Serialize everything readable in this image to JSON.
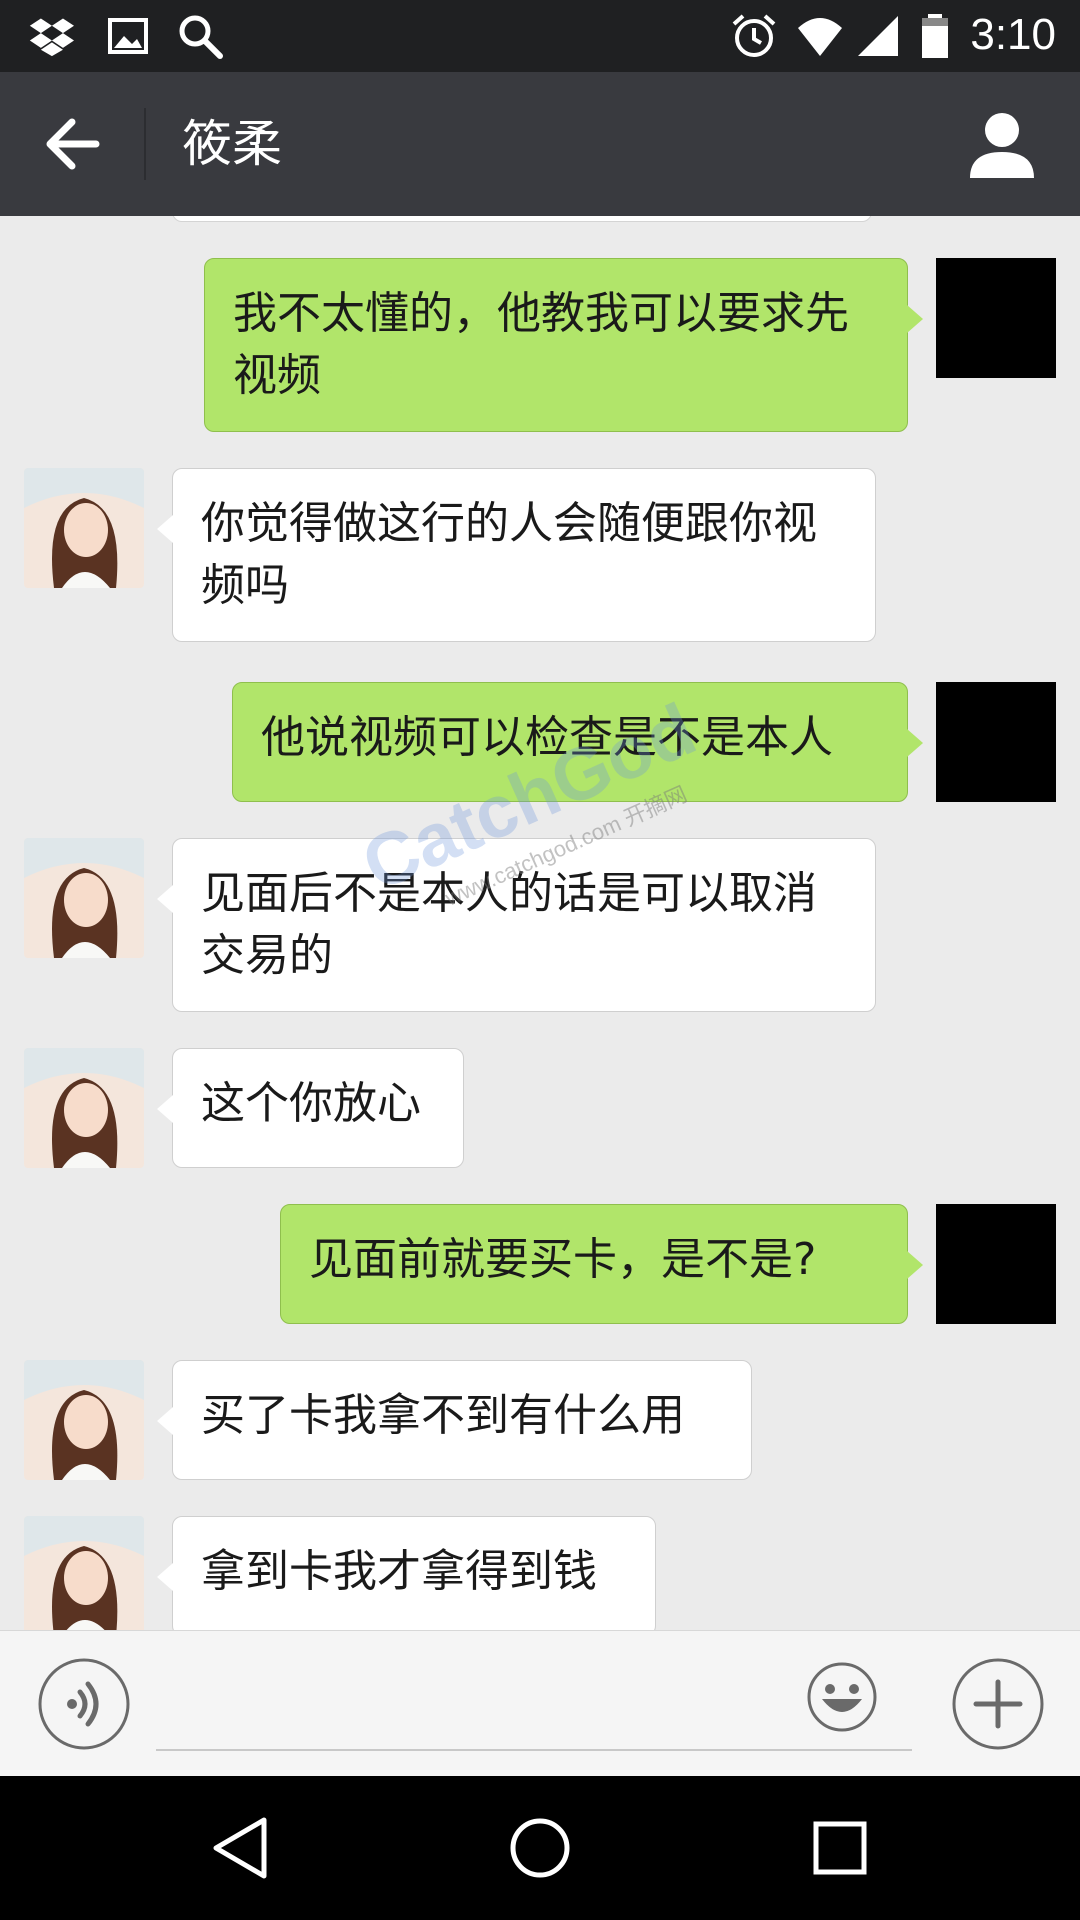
{
  "status_bar": {
    "time": "3:10",
    "left_icons": [
      "dropbox-icon",
      "image-icon",
      "search-icon"
    ],
    "right_icons": [
      "alarm-icon",
      "wifi-icon",
      "signal-icon",
      "battery-icon"
    ]
  },
  "header": {
    "title": "筱柔"
  },
  "messages": [
    {
      "side": "sent",
      "text": "我不太懂的，他教我可以要求先视频"
    },
    {
      "side": "received",
      "text": "你觉得做这行的人会随便跟你视频吗"
    },
    {
      "side": "sent",
      "text": "他说视频可以检查是不是本人"
    },
    {
      "side": "received",
      "text": "见面后不是本人的话是可以取消交易的"
    },
    {
      "side": "received",
      "text": "这个你放心"
    },
    {
      "side": "sent",
      "text": "见面前就要买卡，是不是?"
    },
    {
      "side": "received",
      "text": "买了卡我拿不到有什么用"
    },
    {
      "side": "received",
      "text": "拿到卡我才拿得到钱"
    }
  ],
  "watermark": {
    "main": "CatchGod",
    "sub": "www.catchgod.com 开摘网"
  },
  "input_bar": {
    "placeholder": ""
  },
  "colors": {
    "sent_bubble": "#b1e56a",
    "received_bubble": "#ffffff",
    "title_bar": "#393a3f",
    "status_bar": "#1f2022"
  }
}
